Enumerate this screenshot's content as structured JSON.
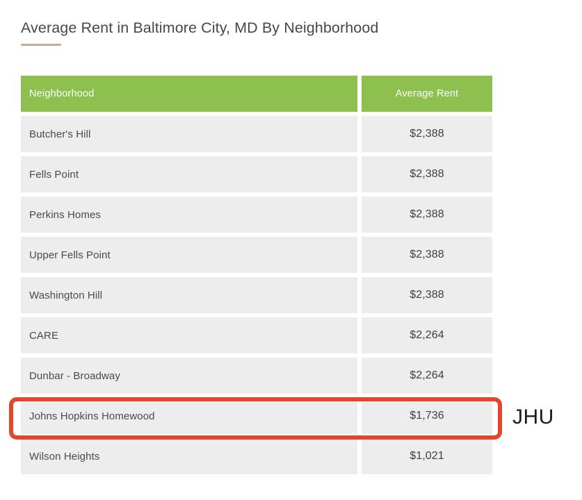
{
  "document": {
    "title": "Average Rent in Baltimore City, MD By Neighborhood"
  },
  "colors": {
    "header_green": "#8dc04e",
    "row_gray": "#ededed",
    "title_rule": "#c9a897",
    "annotation_red": "#e2462b",
    "text_dark": "#4a4a4a"
  },
  "table": {
    "columns": [
      {
        "key": "neighborhood",
        "label": "Neighborhood",
        "align": "left"
      },
      {
        "key": "average_rent",
        "label": "Average Rent",
        "align": "center"
      }
    ],
    "rows": [
      {
        "neighborhood": "Butcher's Hill",
        "average_rent": "$2,388",
        "highlighted": false
      },
      {
        "neighborhood": "Fells Point",
        "average_rent": "$2,388",
        "highlighted": false
      },
      {
        "neighborhood": "Perkins Homes",
        "average_rent": "$2,388",
        "highlighted": false
      },
      {
        "neighborhood": "Upper Fells Point",
        "average_rent": "$2,388",
        "highlighted": false
      },
      {
        "neighborhood": "Washington Hill",
        "average_rent": "$2,388",
        "highlighted": false
      },
      {
        "neighborhood": "CARE",
        "average_rent": "$2,264",
        "highlighted": false
      },
      {
        "neighborhood": "Dunbar - Broadway",
        "average_rent": "$2,264",
        "highlighted": false
      },
      {
        "neighborhood": "Johns Hopkins Homewood",
        "average_rent": "$1,736",
        "highlighted": true
      },
      {
        "neighborhood": "Wilson Heights",
        "average_rent": "$1,021",
        "highlighted": false
      }
    ]
  },
  "annotation": {
    "label": "JHU",
    "target_row": "Johns Hopkins Homewood"
  }
}
